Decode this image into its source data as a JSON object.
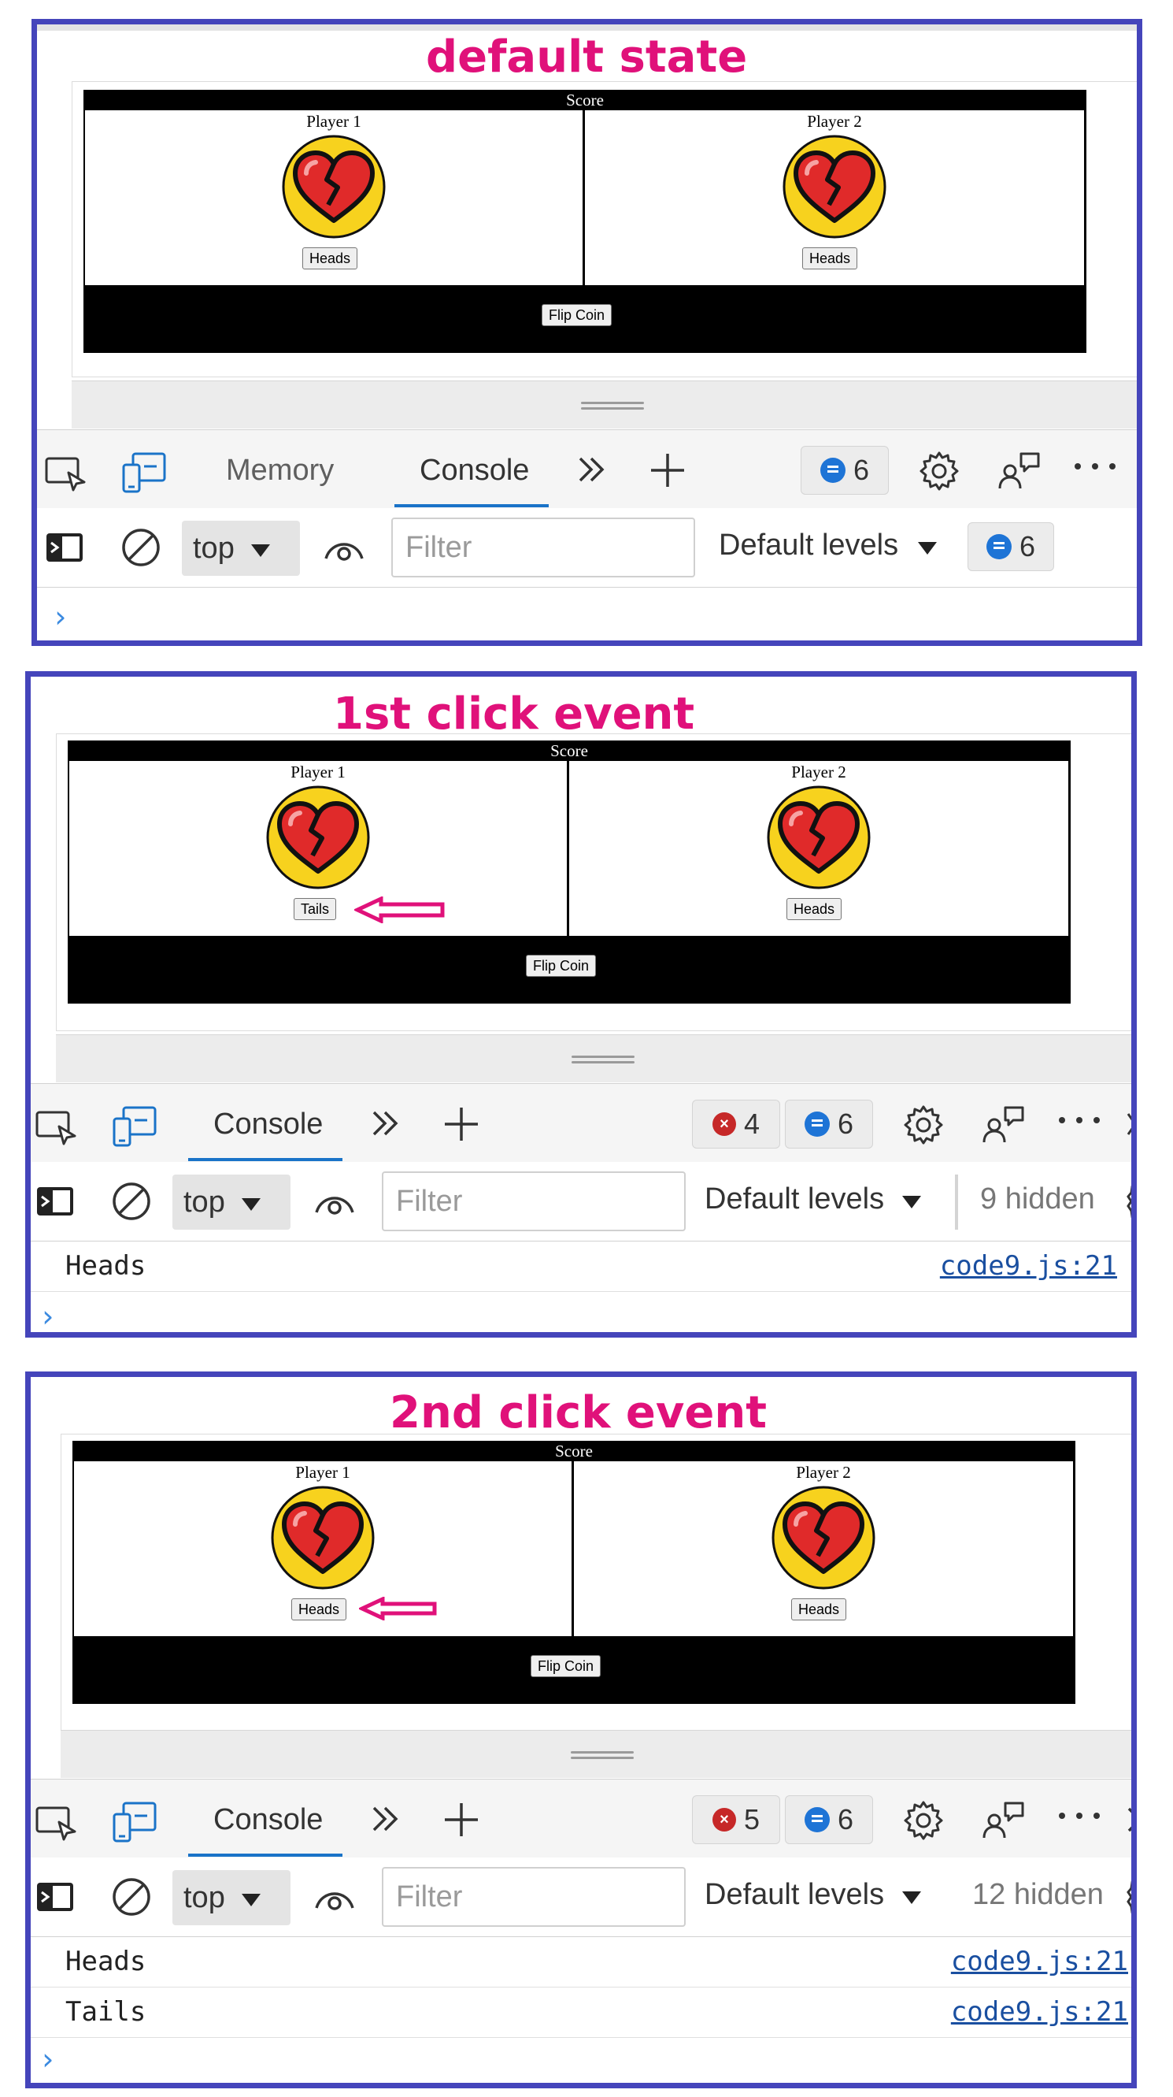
{
  "panels": [
    {
      "caption": "default state",
      "game": {
        "score_title": "Score",
        "players": [
          {
            "name": "Player 1",
            "button": "Heads"
          },
          {
            "name": "Player 2",
            "button": "Heads"
          }
        ],
        "flip_label": "Flip Coin"
      },
      "devtools": {
        "tabs": [
          "Memory",
          "Console"
        ],
        "active_tab": "Console",
        "message_count": "6",
        "context": "top",
        "filter_placeholder": "Filter",
        "levels": "Default levels",
        "filter_message_count": "6",
        "logs": []
      }
    },
    {
      "caption": "1st click event",
      "game": {
        "score_title": "Score",
        "players": [
          {
            "name": "Player 1",
            "button": "Tails"
          },
          {
            "name": "Player 2",
            "button": "Heads"
          }
        ],
        "flip_label": "Flip Coin"
      },
      "devtools": {
        "tabs": [
          "Console"
        ],
        "active_tab": "Console",
        "error_count": "4",
        "message_count": "6",
        "context": "top",
        "filter_placeholder": "Filter",
        "levels": "Default levels",
        "hidden": "9 hidden",
        "logs": [
          {
            "text": "Heads",
            "source": "code9.js:21"
          }
        ]
      }
    },
    {
      "caption": "2nd click event",
      "game": {
        "score_title": "Score",
        "players": [
          {
            "name": "Player 1",
            "button": "Heads"
          },
          {
            "name": "Player 2",
            "button": "Heads"
          }
        ],
        "flip_label": "Flip Coin"
      },
      "devtools": {
        "tabs": [
          "Console"
        ],
        "active_tab": "Console",
        "error_count": "5",
        "message_count": "6",
        "context": "top",
        "filter_placeholder": "Filter",
        "levels": "Default levels",
        "hidden": "12 hidden",
        "logs": [
          {
            "text": "Heads",
            "source": "code9.js:21"
          },
          {
            "text": "Tails",
            "source": "code9.js:21"
          }
        ]
      }
    }
  ],
  "colors": {
    "frame": "#4545bb",
    "caption": "#e0117a",
    "coin": "#f7d21e",
    "heart": "#e02a2a",
    "arrow": "#e0117a"
  },
  "icons": [
    "inspect-icon",
    "device-toggle-icon",
    "more-tabs-icon",
    "add-tab-icon",
    "settings-icon",
    "feedback-icon",
    "more-options-icon",
    "sidebar-toggle-icon",
    "clear-console-icon",
    "dropdown-icon",
    "live-expression-icon",
    "message-icon",
    "error-icon",
    "prompt-icon",
    "broken-heart-icon",
    "arrow-icon"
  ]
}
